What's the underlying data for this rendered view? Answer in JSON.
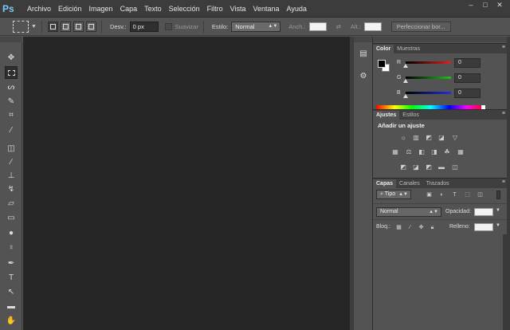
{
  "app": {
    "logo": "Ps"
  },
  "menu": [
    "Archivo",
    "Edición",
    "Imagen",
    "Capa",
    "Texto",
    "Selección",
    "Filtro",
    "Vista",
    "Ventana",
    "Ayuda"
  ],
  "window_controls": {
    "minimize": "–",
    "maximize": "□",
    "close": "✕"
  },
  "options": {
    "feather_label": "Desv.:",
    "feather_value": "0 px",
    "antialias_label": "Suavizar",
    "style_label": "Estilo:",
    "style_value": "Normal",
    "width_label": "Anch.:",
    "height_label": "Alt.:",
    "refine_button": "Perfeccionar bor..."
  },
  "color_panel": {
    "tabs": [
      "Color",
      "Muestras"
    ],
    "channels": [
      {
        "label": "R",
        "value": "0",
        "color": "#e02020"
      },
      {
        "label": "G",
        "value": "0",
        "color": "#20c020"
      },
      {
        "label": "B",
        "value": "0",
        "color": "#2030e0"
      }
    ]
  },
  "adjust_panel": {
    "tabs": [
      "Ajustes",
      "Estilos"
    ],
    "title": "Añadir un ajuste"
  },
  "layers_panel": {
    "tabs": [
      "Capas",
      "Canales",
      "Trazados"
    ],
    "filter_value": "Tipo",
    "blend_value": "Normal",
    "opacity_label": "Opacidad:",
    "lock_label": "Bloq.:",
    "fill_label": "Relleno:"
  },
  "colors": {
    "accent": "#7ec8f5",
    "canvas": "#262626",
    "panel": "#535353"
  }
}
